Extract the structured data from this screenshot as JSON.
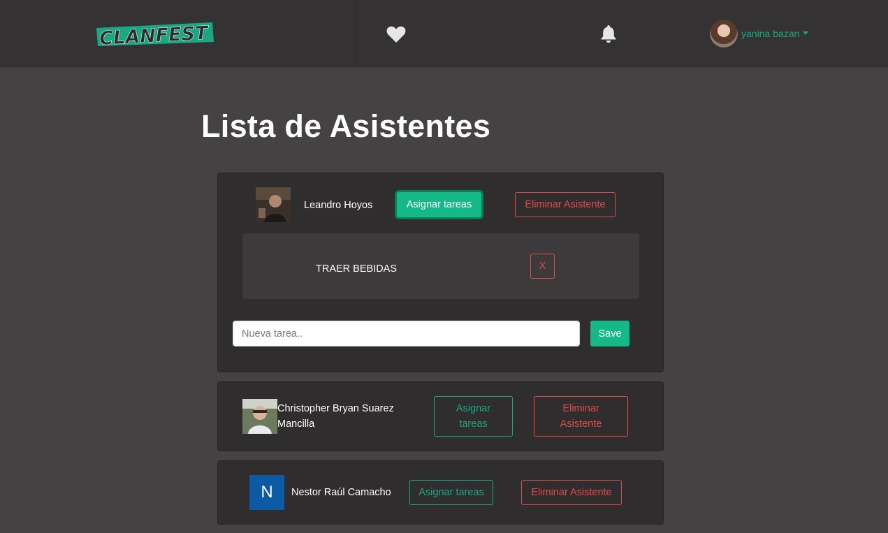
{
  "navbar": {
    "logo_text": "CLANFEST",
    "favorites_icon": "heart-icon",
    "notifications_icon": "bell-icon",
    "user": {
      "name": "yanina bazan",
      "menu_icon": "caret-down-icon"
    }
  },
  "page": {
    "title": "Lista de Asistentes"
  },
  "colors": {
    "accent": "#15b988",
    "danger": "#e24a4a",
    "background": "#454243",
    "navbar": "#343232",
    "card": "#2f2d2d"
  },
  "attendees": [
    {
      "name": "Leandro Hoyos",
      "assign_label": "Asignar tareas",
      "remove_label": "Eliminar Asistente",
      "tasks": [
        {
          "text": "TRAER BEBIDAS",
          "remove_label": "X"
        }
      ],
      "new_task": {
        "placeholder": "Nueva tarea..",
        "value": "",
        "save_label": "Save"
      }
    },
    {
      "name": "Christopher Bryan Suarez Mancilla",
      "assign_label": "Asignar tareas",
      "remove_label": "Eliminar Asistente"
    },
    {
      "name": "Nestor Raúl Camacho",
      "initial": "N",
      "assign_label": "Asignar tareas",
      "remove_label": "Eliminar Asistente"
    }
  ]
}
